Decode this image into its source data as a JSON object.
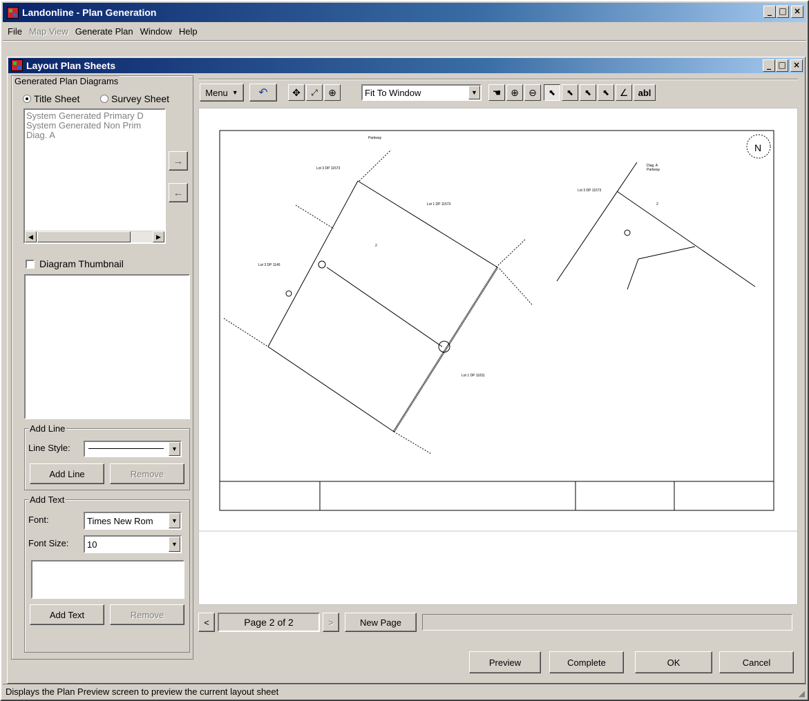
{
  "app": {
    "title": "Landonline - Plan Generation"
  },
  "window_buttons": {
    "minimize": "_",
    "maximize": "□",
    "close": "×"
  },
  "menu": [
    "File",
    "Map View",
    "Generate Plan",
    "Window",
    "Help"
  ],
  "child": {
    "title": "Layout Plan Sheets"
  },
  "diagrams": {
    "group_label": "Generated Plan Diagrams",
    "radio_title": "Title Sheet",
    "radio_survey": "Survey Sheet",
    "selected_radio": "Title Sheet",
    "items": [
      "System Generated Primary D",
      "System Generated Non Prim",
      "Diag. A"
    ],
    "move_right": "→",
    "move_left": "←"
  },
  "thumbnail": {
    "label": "Diagram Thumbnail",
    "checked": false
  },
  "add_line": {
    "group_label": "Add Line",
    "style_label": "Line Style:",
    "add_button": "Add Line",
    "remove_button": "Remove"
  },
  "add_text": {
    "group_label": "Add Text",
    "font_label": "Font:",
    "font_value": "Times New Rom",
    "size_label": "Font Size:",
    "size_value": "10",
    "add_button": "Add Text",
    "remove_button": "Remove"
  },
  "toolbar": {
    "menu_button": "Menu",
    "zoom_option": "Fit To Window",
    "text_tool": "abl",
    "icons": [
      "undo-icon",
      "pan-arrows-icon",
      "fit-extents-icon",
      "zoom-window-icon",
      "hand-pan-icon",
      "zoom-in-icon",
      "zoom-out-icon",
      "select-icon",
      "select-add-icon",
      "select-remove-icon",
      "select-edit-icon",
      "draw-line-icon",
      "text-tool-icon"
    ]
  },
  "plan": {
    "north": "N",
    "left_labels": [
      "Lot 3 DP 11573",
      "Lot 1 DP 11573",
      "Lot 3 DP 1145",
      "Lot 1 DP 11811"
    ],
    "left_road": "Parkway",
    "right_labels": [
      "Diag. A",
      "Parkway",
      "Lot 3 DP 11573"
    ],
    "lot_number": "2"
  },
  "pager": {
    "prev": "<",
    "page_text": "Page 2 of 2",
    "next": ">",
    "new_page": "New Page"
  },
  "actions": {
    "preview": "Preview",
    "complete": "Complete",
    "ok": "OK",
    "cancel": "Cancel"
  },
  "status": {
    "text": "Displays the Plan Preview screen to preview the current layout sheet"
  }
}
